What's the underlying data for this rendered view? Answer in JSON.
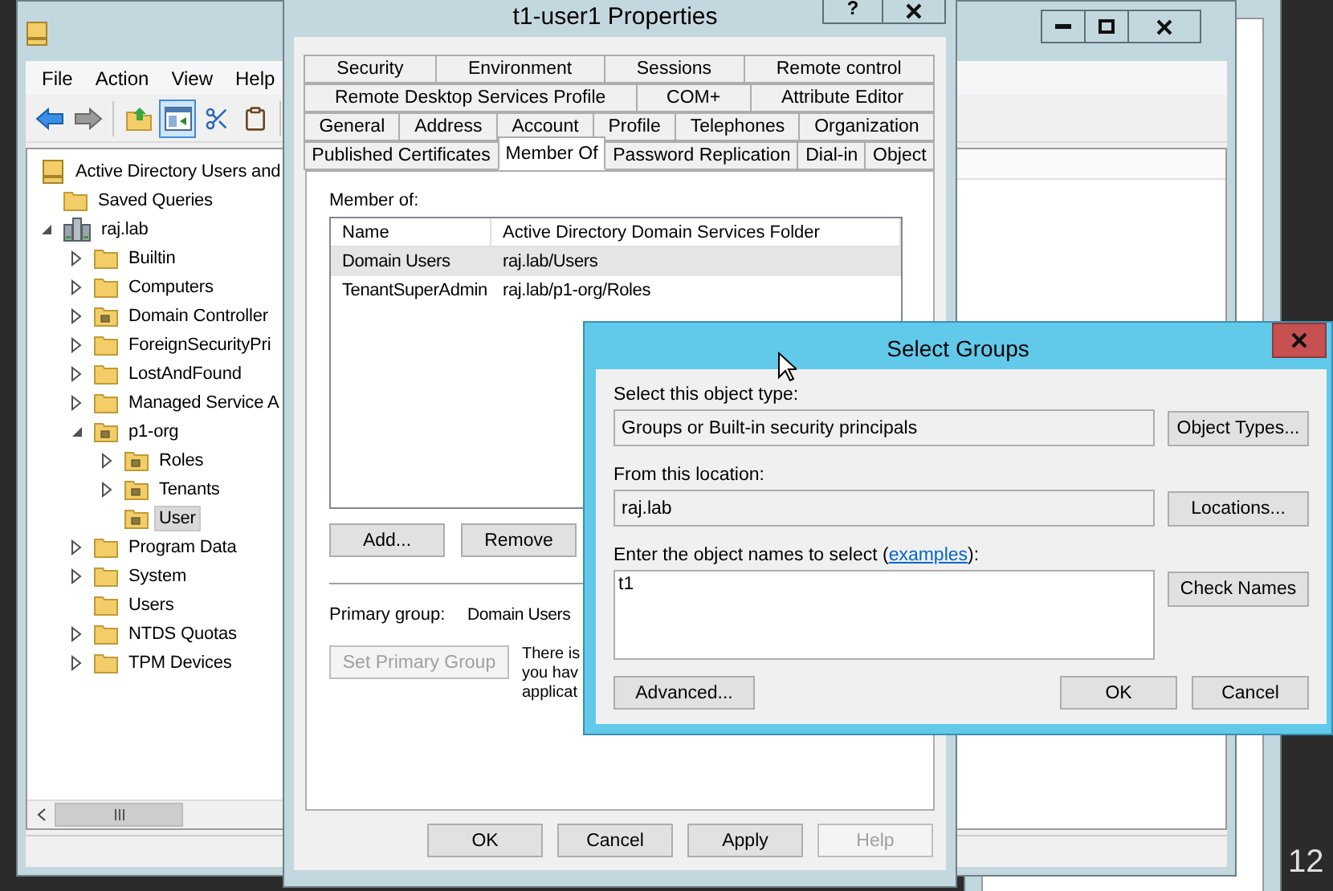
{
  "desktop_text": "12",
  "main_window": {
    "menu": [
      "File",
      "Action",
      "View",
      "Help"
    ],
    "toolbar": [
      {
        "kind": "back",
        "selected": false
      },
      {
        "kind": "forward",
        "selected": false
      },
      {
        "kind": "up",
        "selected": false
      },
      {
        "kind": "pane",
        "selected": true
      },
      {
        "kind": "cut",
        "selected": false
      },
      {
        "kind": "paste",
        "selected": false
      }
    ],
    "tree": [
      {
        "label": "Active Directory Users and",
        "kind": "root",
        "selected": false,
        "children": [
          {
            "label": "Saved Queries",
            "kind": "folder",
            "selected": false
          },
          {
            "label": "raj.lab",
            "kind": "domain",
            "expanded": true,
            "selected": false,
            "children": [
              {
                "label": "Builtin",
                "kind": "folder",
                "expanded": false,
                "selected": false
              },
              {
                "label": "Computers",
                "kind": "folder",
                "expanded": false,
                "selected": false
              },
              {
                "label": "Domain Controller",
                "kind": "ou",
                "expanded": false,
                "selected": false
              },
              {
                "label": "ForeignSecurityPri",
                "kind": "folder",
                "expanded": false,
                "selected": false
              },
              {
                "label": "LostAndFound",
                "kind": "folder",
                "expanded": false,
                "selected": false
              },
              {
                "label": "Managed Service A",
                "kind": "folder",
                "expanded": false,
                "selected": false
              },
              {
                "label": "p1-org",
                "kind": "ou",
                "expanded": true,
                "selected": false,
                "children": [
                  {
                    "label": "Roles",
                    "kind": "ou",
                    "expanded": false,
                    "selected": false
                  },
                  {
                    "label": "Tenants",
                    "kind": "ou",
                    "expanded": false,
                    "selected": false
                  },
                  {
                    "label": "User",
                    "kind": "ou",
                    "selected": true
                  }
                ]
              },
              {
                "label": "Program Data",
                "kind": "folder",
                "expanded": false,
                "selected": false
              },
              {
                "label": "System",
                "kind": "folder",
                "expanded": false,
                "selected": false
              },
              {
                "label": "Users",
                "kind": "folder",
                "selected": false
              },
              {
                "label": "NTDS Quotas",
                "kind": "folder",
                "expanded": false,
                "selected": false
              },
              {
                "label": "TPM Devices",
                "kind": "folder",
                "expanded": false,
                "selected": false
              }
            ]
          }
        ]
      }
    ]
  },
  "properties_dialog": {
    "title": "t1-user1 Properties",
    "help_button": "?",
    "tab_rows": [
      {
        "tabs": [
          {
            "label": "Security",
            "selected": false
          },
          {
            "label": "Environment",
            "selected": false
          },
          {
            "label": "Sessions",
            "selected": false
          },
          {
            "label": "Remote control",
            "selected": false
          }
        ]
      },
      {
        "tabs": [
          {
            "label": "Remote Desktop Services Profile",
            "selected": false
          },
          {
            "label": "COM+",
            "selected": false
          },
          {
            "label": "Attribute Editor",
            "selected": false
          }
        ]
      },
      {
        "tabs": [
          {
            "label": "General",
            "selected": false
          },
          {
            "label": "Address",
            "selected": false
          },
          {
            "label": "Account",
            "selected": false
          },
          {
            "label": "Profile",
            "selected": false
          },
          {
            "label": "Telephones",
            "selected": false
          },
          {
            "label": "Organization",
            "selected": false
          }
        ]
      },
      {
        "tabs": [
          {
            "label": "Published Certificates",
            "selected": false
          },
          {
            "label": "Member Of",
            "selected": true
          },
          {
            "label": "Password Replication",
            "selected": false
          },
          {
            "label": "Dial-in",
            "selected": false
          },
          {
            "label": "Object",
            "selected": false
          }
        ]
      }
    ],
    "member_of_label": "Member of:",
    "member_list": {
      "columns": [
        "Name",
        "Active Directory Domain Services Folder"
      ],
      "rows": [
        {
          "cells": [
            "Domain Users",
            "raj.lab/Users"
          ],
          "selected": true
        },
        {
          "cells": [
            "TenantSuperAdmin",
            "raj.lab/p1-org/Roles"
          ],
          "selected": false
        }
      ]
    },
    "list_buttons": [
      {
        "label": "Add...",
        "disabled": false
      },
      {
        "label": "Remove",
        "disabled": false
      }
    ],
    "primary_group_label": "Primary group:",
    "primary_group_value": "Domain Users",
    "set_primary_button": {
      "label": "Set Primary Group",
      "disabled": true
    },
    "note_lines": [
      "There is",
      "you hav",
      "applicat"
    ],
    "footer_buttons": [
      {
        "label": "OK",
        "disabled": false
      },
      {
        "label": "Cancel",
        "disabled": false
      },
      {
        "label": "Apply",
        "disabled": false
      },
      {
        "label": "Help",
        "disabled": true
      }
    ]
  },
  "select_dialog": {
    "title": "Select Groups",
    "object_type": {
      "label": "Select this object type:",
      "value": "Groups or Built-in security principals",
      "button": "Object Types..."
    },
    "location": {
      "label": "From this location:",
      "value": "raj.lab",
      "button": "Locations..."
    },
    "names": {
      "label": "Enter the object names to select (",
      "link": "examples",
      "label_end": "):",
      "value": "t1",
      "button": "Check Names"
    },
    "advanced_button": "Advanced...",
    "footer_buttons": [
      "OK",
      "Cancel"
    ]
  }
}
